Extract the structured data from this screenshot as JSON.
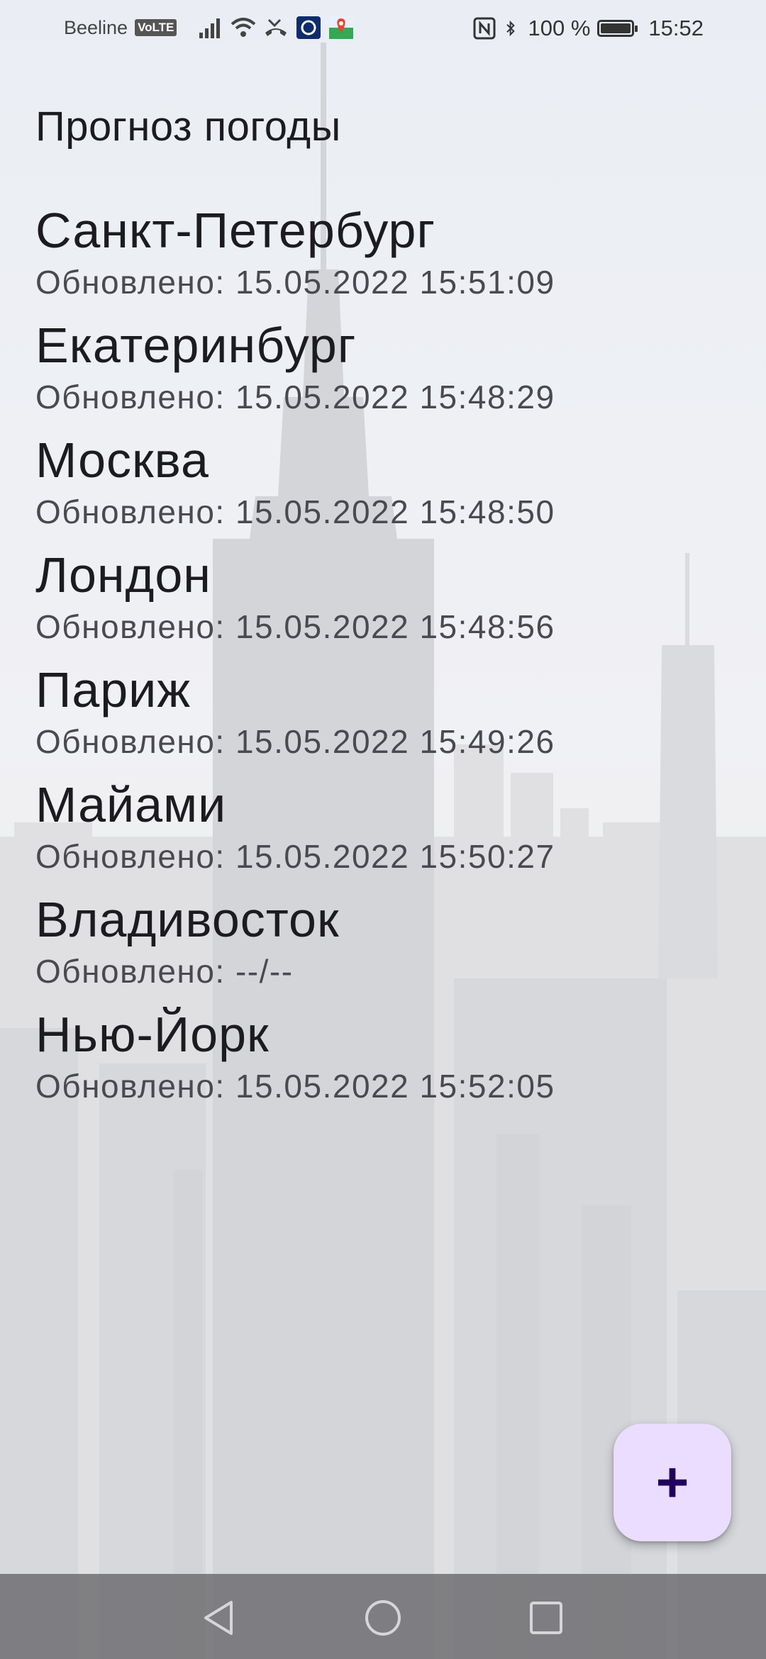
{
  "status_bar": {
    "carrier": "Beeline",
    "volte": "VoLTE",
    "battery": "100 %",
    "time": "15:52"
  },
  "title": "Прогноз погоды",
  "cities": [
    {
      "name": "Санкт-Петербург",
      "updated": "Обновлено: 15.05.2022 15:51:09"
    },
    {
      "name": "Екатеринбург",
      "updated": "Обновлено: 15.05.2022 15:48:29"
    },
    {
      "name": "Москва",
      "updated": "Обновлено: 15.05.2022 15:48:50"
    },
    {
      "name": "Лондон",
      "updated": "Обновлено: 15.05.2022 15:48:56"
    },
    {
      "name": "Париж",
      "updated": "Обновлено: 15.05.2022 15:49:26"
    },
    {
      "name": "Майами",
      "updated": "Обновлено: 15.05.2022 15:50:27"
    },
    {
      "name": "Владивосток",
      "updated": "Обновлено: --/--"
    },
    {
      "name": "Нью-Йорк",
      "updated": "Обновлено: 15.05.2022 15:52:05"
    }
  ],
  "fab": {
    "icon": "plus-icon",
    "label": "+"
  },
  "colors": {
    "fab_bg": "#eaddff",
    "fab_icon": "#21005d"
  }
}
